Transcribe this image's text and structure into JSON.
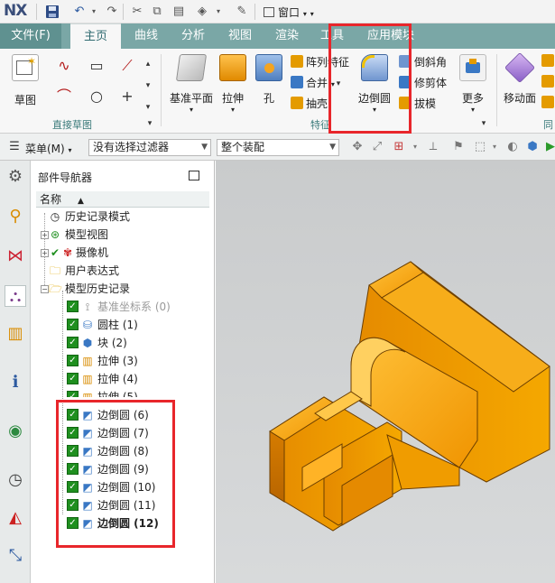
{
  "app": {
    "logo": "NX",
    "window_menu": "窗口"
  },
  "tabs": [
    {
      "label": "文件(F)"
    },
    {
      "label": "主页"
    },
    {
      "label": "曲线"
    },
    {
      "label": "分析"
    },
    {
      "label": "视图"
    },
    {
      "label": "渲染"
    },
    {
      "label": "工具"
    },
    {
      "label": "应用模块"
    }
  ],
  "ribbon": {
    "sketch": "草图",
    "direct_sketch_group": "直接草图",
    "datum_plane": "基准平面",
    "extrude": "拉伸",
    "hole": "孔",
    "pattern_feature": "阵列特征",
    "unite": "合并",
    "shell": "抽壳",
    "feature_group": "特征",
    "edge_blend": "边倒圆",
    "chamfer": "倒斜角",
    "trim_body": "修剪体",
    "draft": "拔模",
    "more": "更多",
    "move_face": "移动面",
    "sync_group": "同步"
  },
  "selection_bar": {
    "menu": "菜单(M)",
    "filter": "没有选择过滤器",
    "scope": "整个装配"
  },
  "navigator": {
    "title": "部件导航器",
    "column_name": "名称",
    "items": [
      {
        "label": "历史记录模式"
      },
      {
        "label": "模型视图"
      },
      {
        "label": "摄像机"
      },
      {
        "label": "用户表达式"
      },
      {
        "label": "模型历史记录"
      },
      {
        "label": "基准坐标系 (0)"
      },
      {
        "label": "圆柱 (1)"
      },
      {
        "label": "块 (2)"
      },
      {
        "label": "拉伸 (3)"
      },
      {
        "label": "拉伸 (4)"
      },
      {
        "label": "拉伸 (5)"
      },
      {
        "label": "边倒圆 (6)"
      },
      {
        "label": "边倒圆 (7)"
      },
      {
        "label": "边倒圆 (8)"
      },
      {
        "label": "边倒圆 (9)"
      },
      {
        "label": "边倒圆 (10)"
      },
      {
        "label": "边倒圆 (11)"
      },
      {
        "label": "边倒圆 (12)"
      }
    ]
  },
  "colors": {
    "tab_bar": "#7aa7a6",
    "model_orange": "#f29a00",
    "highlight_red": "#e8262b",
    "check_green": "#1f8f1f"
  }
}
